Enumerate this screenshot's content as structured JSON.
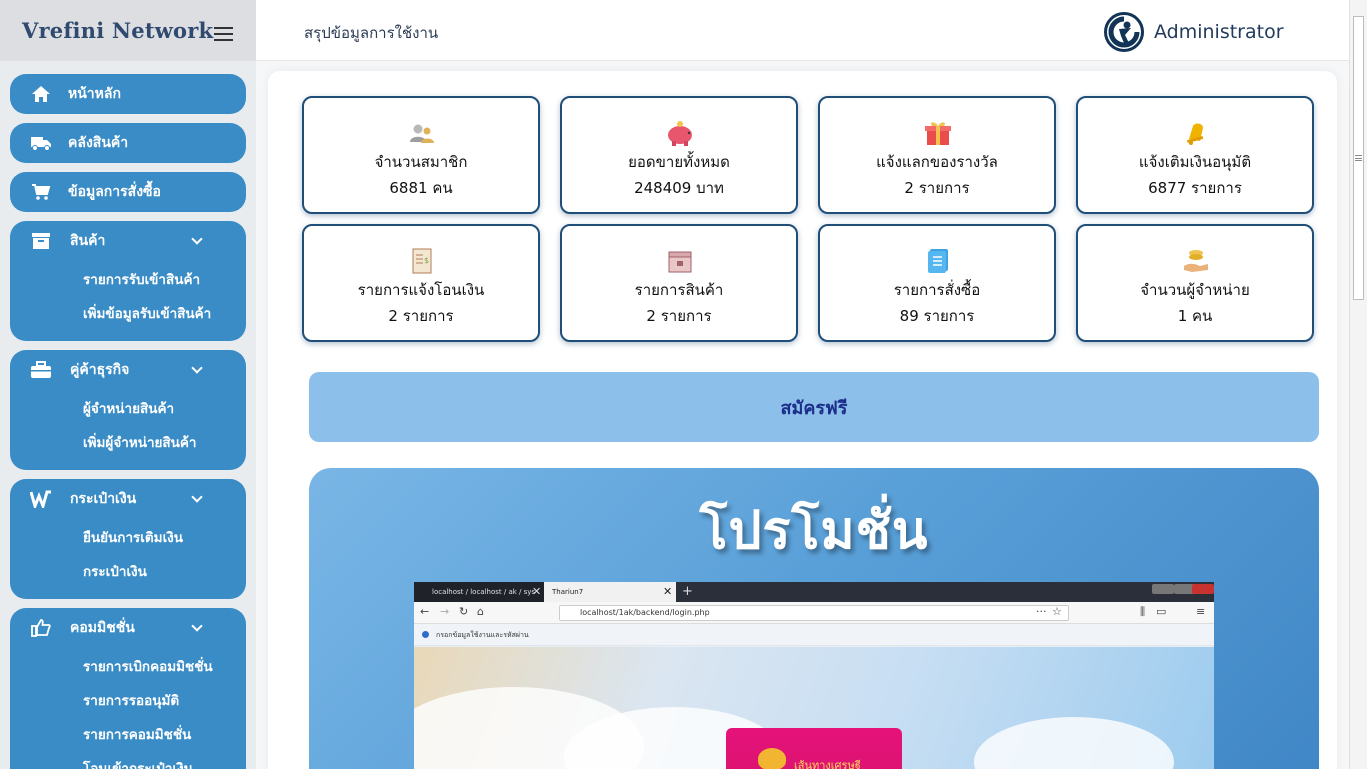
{
  "brand": {
    "name": "Vrefini Network"
  },
  "sidebar": {
    "items": [
      {
        "label": "หน้าหลัก",
        "icon": "home-icon"
      },
      {
        "label": "คลังสินค้า",
        "icon": "truck-icon"
      },
      {
        "label": "ข้อมูลการสั่งซื้อ",
        "icon": "cart-icon"
      }
    ],
    "groups": [
      {
        "label": "สินค้า",
        "icon": "archive-box-icon",
        "children": [
          "รายการรับเข้าสินค้า",
          "เพิ่มข้อมูลรับเข้าสินค้า"
        ]
      },
      {
        "label": "คู่ค้าธุรกิจ",
        "icon": "briefcase-icon",
        "children": [
          "ผู้จำหน่ายสินค้า",
          "เพิ่มผู้จำหน่ายสินค้า"
        ]
      },
      {
        "label": "กระเป๋าเงิน",
        "icon": "wallet-w-icon",
        "children": [
          "ยืนยันการเติมเงิน",
          "กระเป๋าเงิน"
        ]
      },
      {
        "label": "คอมมิชชั่น",
        "icon": "thumbs-up-icon",
        "children": [
          "รายการเบิกคอมมิชชั่น",
          "รายการรออนุมัติ",
          "รายการคอมมิชชั่น",
          "โอนเข้ากระเป๋าเงิน"
        ]
      }
    ]
  },
  "header": {
    "title": "สรุปข้อมูลการใช้งาน",
    "user": "Administrator"
  },
  "stats": [
    {
      "title": "จำนวนสมาชิก",
      "value": "6881 คน",
      "icon": "users-icon"
    },
    {
      "title": "ยอดขายทั้งหมด",
      "value": "248409 บาท",
      "icon": "piggy-bank-icon"
    },
    {
      "title": "แจ้งแลกของรางวัล",
      "value": "2 รายการ",
      "icon": "gift-icon"
    },
    {
      "title": "แจ้งเติมเงินอนุมัติ",
      "value": "6877 รายการ",
      "icon": "bell-icon"
    },
    {
      "title": "รายการแจ้งโอนเงิน",
      "value": "2 รายการ",
      "icon": "receipt-icon"
    },
    {
      "title": "รายการสินค้า",
      "value": "2 รายการ",
      "icon": "package-icon"
    },
    {
      "title": "รายการสั่งซื้อ",
      "value": "89 รายการ",
      "icon": "notebook-icon"
    },
    {
      "title": "จำนวนผู้จำหน่าย",
      "value": "1 คน",
      "icon": "hand-coins-icon"
    }
  ],
  "signup": {
    "label": "สมัครฟรี"
  },
  "promo": {
    "title": "โปรโมชั่น",
    "screenshot": {
      "tab1": "localhost / localhost / ak / sys",
      "tab2": "Thariun7",
      "url": "localhost/1ak/backend/login.php",
      "notice": "กรอกข้อมูลใช้งานและรหัสผ่าน",
      "card_text": "เส้นทางเศรษฐี"
    }
  },
  "colors": {
    "sidebar_pill": "#3a8cc7",
    "card_border": "#1f4e79",
    "signup_bg": "#8cc0ea",
    "promo_bg": "#5aa0d8"
  }
}
